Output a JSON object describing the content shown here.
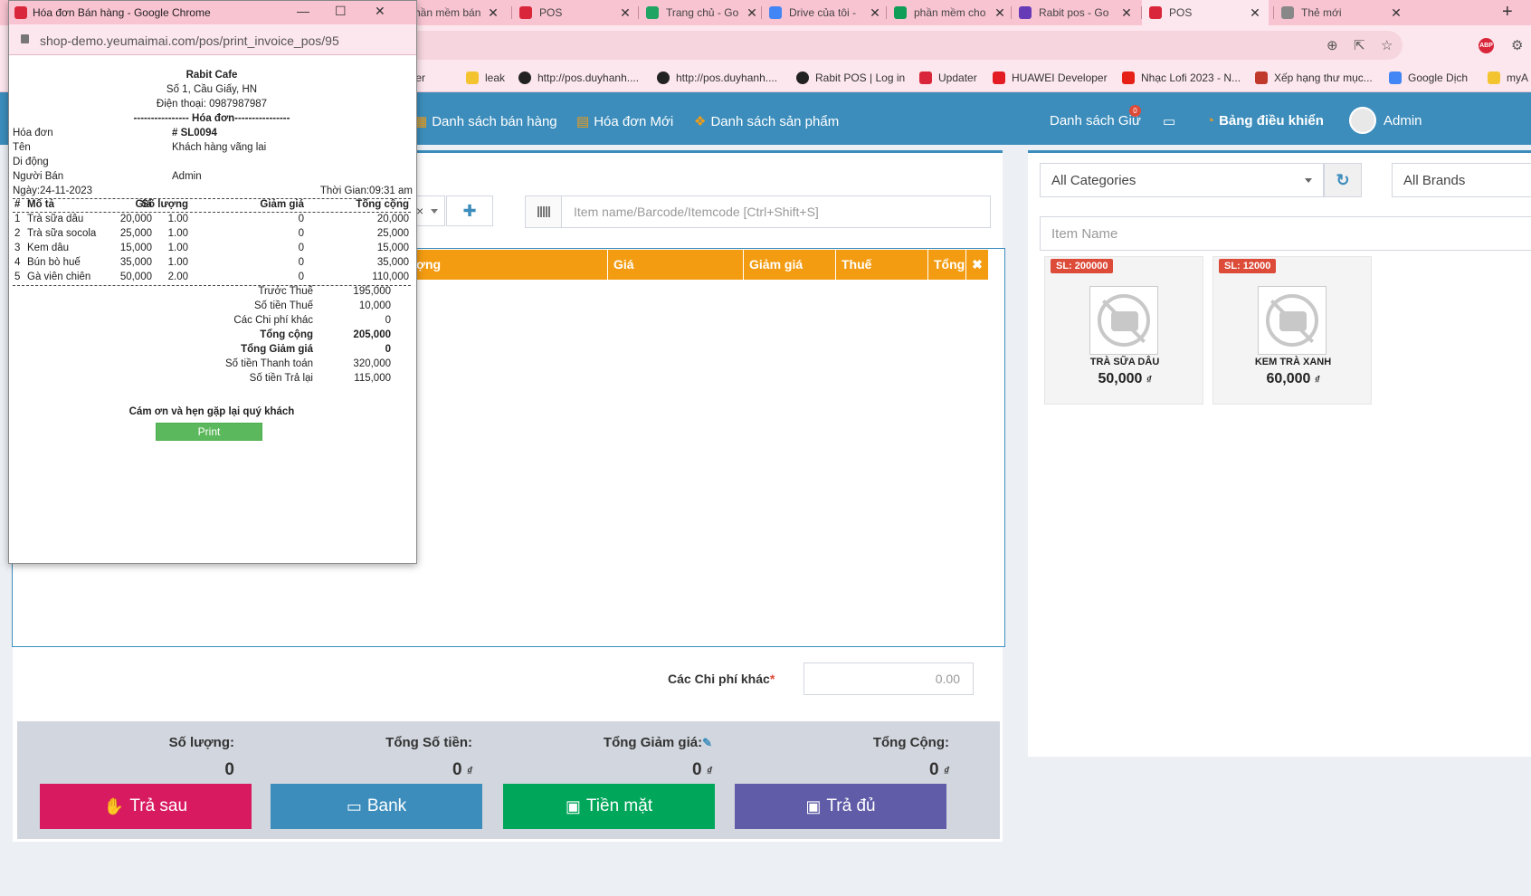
{
  "browser": {
    "tabs": [
      {
        "title": "Phần mềm bán",
        "color": "#e62117"
      },
      {
        "title": "POS",
        "color": "#d9263a"
      },
      {
        "title": "Trang chủ - Go",
        "color": "#1fa463"
      },
      {
        "title": "Drive của tôi - ",
        "color": "#4285f4"
      },
      {
        "title": "phần mềm cho",
        "color": "#0f9d58"
      },
      {
        "title": "Rabit pos - Go",
        "color": "#673ab7"
      },
      {
        "title": "POS",
        "color": "#d9263a"
      },
      {
        "title": "Thẻ mới",
        "color": "#888888"
      }
    ],
    "bookmarks": [
      "flutter",
      "leak",
      "http://pos.duyhanh....",
      "http://pos.duyhanh....",
      "Rabit POS | Log in",
      "Updater",
      "HUAWEI Developer",
      "Nhạc Lofi 2023 - N...",
      "Xếp hạng thư mục...",
      "Google Dịch",
      "myA"
    ]
  },
  "popup": {
    "window_title": "Hóa đơn Bán hàng - Google Chrome",
    "url": "shop-demo.yeumaimai.com/pos/print_invoice_pos/95",
    "shop_name": "Rabit Cafe",
    "address": "Số 1, Cầu Giấy, HN",
    "phone": "Điện thoại: 0987987987",
    "section_title": "---------------- Hóa đơn----------------",
    "fields": [
      {
        "label": "Hóa đơn",
        "value": "# SL0094"
      },
      {
        "label": "Tên",
        "value": "Khách hàng vãng lai"
      },
      {
        "label": "Di động",
        "value": ""
      },
      {
        "label": "Người Bán",
        "value": "Admin"
      }
    ],
    "date": "Ngày:24-11-2023",
    "time": "Thời Gian:09:31 am",
    "columns": [
      "#",
      "Mô tả",
      "Giá",
      "Số lượng",
      "Giảm giá",
      "Tổng cộng"
    ],
    "rows": [
      [
        "1",
        "Trà sữa dâu",
        "20,000",
        "1.00",
        "0",
        "20,000"
      ],
      [
        "2",
        "Trà sữa socola",
        "25,000",
        "1.00",
        "0",
        "25,000"
      ],
      [
        "3",
        "Kem dâu",
        "15,000",
        "1.00",
        "0",
        "15,000"
      ],
      [
        "4",
        "Bún bò huế",
        "35,000",
        "1.00",
        "0",
        "35,000"
      ],
      [
        "5",
        "Gà viên chiên",
        "50,000",
        "2.00",
        "0",
        "110,000"
      ]
    ],
    "totals": [
      {
        "label": "Trước Thuế",
        "value": "195,000",
        "bold": false
      },
      {
        "label": "Số tiền Thuế",
        "value": "10,000",
        "bold": false
      },
      {
        "label": "Các Chi phí khác",
        "value": "0",
        "bold": false
      },
      {
        "label": "Tổng cộng",
        "value": "205,000",
        "bold": true
      },
      {
        "label": "Tổng Giảm giá",
        "value": "0",
        "bold": true
      },
      {
        "label": "Số tiền Thanh toán",
        "value": "320,000",
        "bold": false
      },
      {
        "label": "Số tiền Trả lại",
        "value": "115,000",
        "bold": false
      }
    ],
    "thanks": "Cám ơn và hẹn gặp lại quý khách",
    "print_label": "Print"
  },
  "navbar": {
    "sales_list": "Danh sách bán hàng",
    "new_invoice": "Hóa đơn Mới",
    "product_list": "Danh sách sản phẩm",
    "held_list": "Danh sách Giữ",
    "held_count": "0",
    "dashboard": "Bảng điều khiển",
    "user": "Admin"
  },
  "pos": {
    "barcode_placeholder": "Item name/Barcode/Itemcode [Ctrl+Shift+S]",
    "table_headers": [
      "lượng",
      "Giá",
      "Giảm giá",
      "Thuế",
      "Tổng"
    ],
    "other_charges_label": "Các Chi phí khác",
    "other_charges_value": "0.00",
    "summary": [
      {
        "label": "Số lượng:",
        "value": "0",
        "currency": ""
      },
      {
        "label": "Tổng Số tiền:",
        "value": "0",
        "currency": "₫"
      },
      {
        "label": "Tổng Giảm giá:",
        "value": "0",
        "currency": "₫"
      },
      {
        "label": "Tổng Cộng:",
        "value": "0",
        "currency": "₫"
      }
    ],
    "buttons": [
      {
        "label": "Trả sau",
        "color": "#d81b60"
      },
      {
        "label": "Bank",
        "color": "#3c8dbc"
      },
      {
        "label": "Tiền mặt",
        "color": "#00a65a"
      },
      {
        "label": "Trả đủ",
        "color": "#605ca8"
      }
    ]
  },
  "products_panel": {
    "category": "All Categories",
    "brand": "All Brands",
    "item_name_placeholder": "Item Name",
    "products": [
      {
        "stock": "SL: 200000",
        "name": "TRÀ SỮA DÂU",
        "price": "50,000",
        "currency": "₫"
      },
      {
        "stock": "SL: 12000",
        "name": "KEM TRÀ XANH",
        "price": "60,000",
        "currency": "₫"
      }
    ]
  }
}
